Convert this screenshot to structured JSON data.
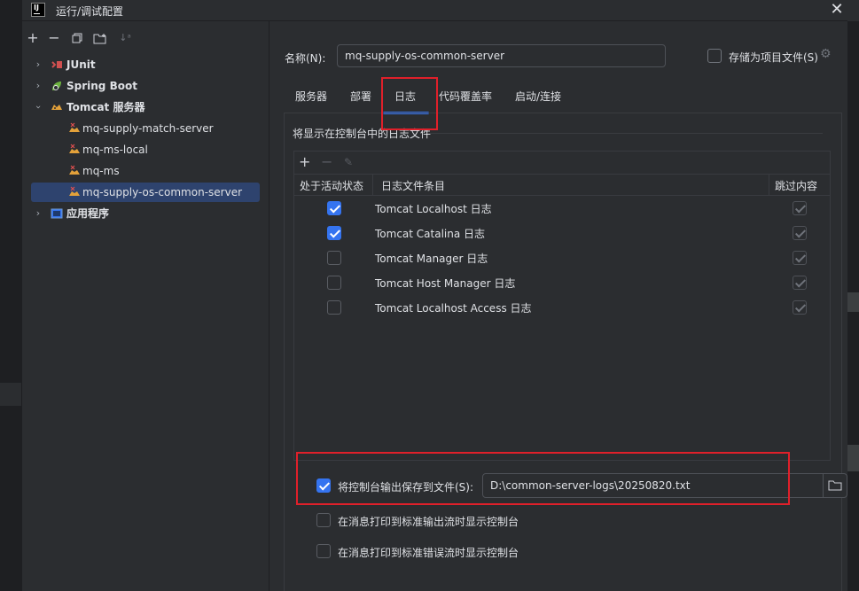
{
  "window": {
    "title": "运行/调试配置",
    "app_icon_text": "IJ"
  },
  "toolbar": {
    "items": [
      "add",
      "remove",
      "copy",
      "new-folder",
      "sort"
    ]
  },
  "tree": [
    {
      "label": "JUnit",
      "icon": "junit-icon",
      "expanded": false,
      "bold": true
    },
    {
      "label": "Spring Boot",
      "icon": "spring-boot-icon",
      "expanded": false,
      "bold": true
    },
    {
      "label": "Tomcat 服务器",
      "icon": "tomcat-icon",
      "expanded": true,
      "bold": true
    },
    {
      "label": "mq-supply-match-server",
      "icon": "tomcat-config-icon"
    },
    {
      "label": "mq-ms-local",
      "icon": "tomcat-config-icon"
    },
    {
      "label": "mq-ms",
      "icon": "tomcat-config-icon"
    },
    {
      "label": "mq-supply-os-common-server",
      "icon": "tomcat-config-icon",
      "selected": true
    },
    {
      "label": "应用程序",
      "icon": "application-icon",
      "expanded": false,
      "bold": true
    }
  ],
  "form": {
    "name_label": "名称(N):",
    "name_value": "mq-supply-os-common-server",
    "store_label": "存储为项目文件(S)"
  },
  "tabs": [
    "服务器",
    "部署",
    "日志",
    "代码覆盖率",
    "启动/连接"
  ],
  "active_tab": "日志",
  "logs": {
    "section_title": "将显示在控制台中的日志文件",
    "columns": [
      "处于活动状态",
      "日志文件条目",
      "跳过内容"
    ],
    "rows": [
      {
        "active": true,
        "name": "Tomcat Localhost 日志",
        "skip": true
      },
      {
        "active": true,
        "name": "Tomcat Catalina 日志",
        "skip": true
      },
      {
        "active": false,
        "name": "Tomcat Manager 日志",
        "skip": true
      },
      {
        "active": false,
        "name": "Tomcat Host Manager 日志",
        "skip": true
      },
      {
        "active": false,
        "name": "Tomcat Localhost Access 日志",
        "skip": true
      }
    ]
  },
  "save_output": {
    "checked": true,
    "label": "将控制台输出保存到文件(S):",
    "path": "D:\\common-server-logs\\20250820.txt"
  },
  "options": [
    {
      "checked": false,
      "label": "在消息打印到标准输出流时显示控制台"
    },
    {
      "checked": false,
      "label": "在消息打印到标准错误流时显示控制台"
    }
  ],
  "colors": {
    "accent": "#3574f0",
    "highlight_box": "#e0202a",
    "selection": "#2e436e"
  }
}
